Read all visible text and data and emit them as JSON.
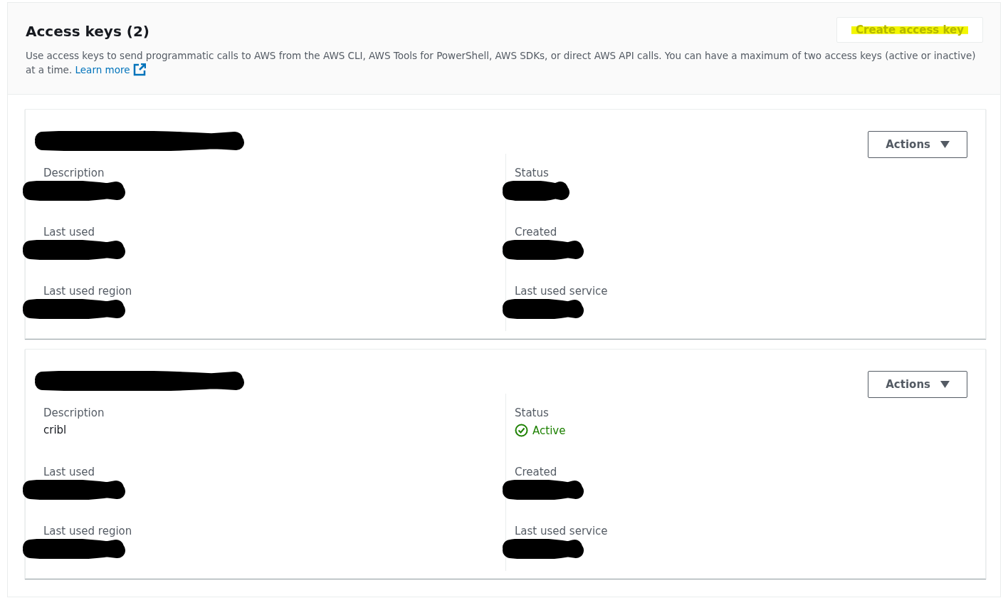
{
  "header": {
    "title": "Access keys (2)",
    "description": "Use access keys to send programmatic calls to AWS from the AWS CLI, AWS Tools for PowerShell, AWS SDKs, or direct AWS API calls. You can have a maximum of two access keys (active or inactive) at a time.",
    "link": "Learn more",
    "create_button": {
      "label": "Create access key",
      "highlighted": true
    }
  },
  "keys": [
    {
      "title_redacted": true,
      "actions_label": "Actions",
      "columns": [
        [
          {
            "label": "Description",
            "kind": "text",
            "redacted": true
          },
          {
            "label": "Last used",
            "kind": "text",
            "redacted": true
          },
          {
            "label": "Last used region",
            "kind": "text",
            "redacted": true
          }
        ],
        [
          {
            "label": "Status",
            "kind": "status",
            "redacted": true
          },
          {
            "label": "Created",
            "kind": "text",
            "redacted": true
          },
          {
            "label": "Last used service",
            "kind": "text",
            "redacted": true
          }
        ]
      ]
    },
    {
      "title_redacted": true,
      "actions_label": "Actions",
      "columns": [
        [
          {
            "label": "Description",
            "kind": "text",
            "redacted": false,
            "value": "cribl"
          },
          {
            "label": "Last used",
            "kind": "text",
            "redacted": true
          },
          {
            "label": "Last used region",
            "kind": "text",
            "redacted": true
          }
        ],
        [
          {
            "label": "Status",
            "kind": "status",
            "redacted": false,
            "value": "Active"
          },
          {
            "label": "Created",
            "kind": "text",
            "redacted": true
          },
          {
            "label": "Last used service",
            "kind": "text",
            "redacted": true
          }
        ]
      ]
    }
  ]
}
